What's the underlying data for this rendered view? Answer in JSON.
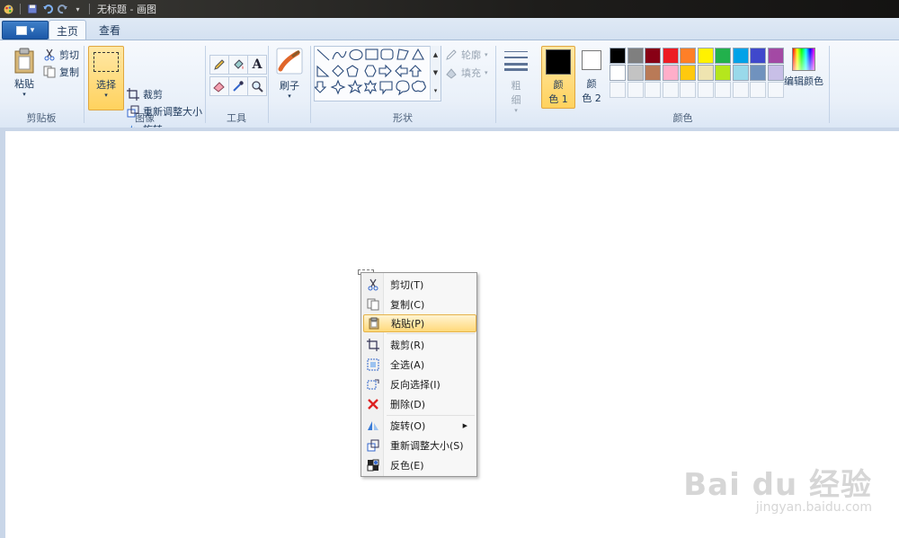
{
  "titlebar": {
    "title": "无标题 - 画图"
  },
  "tabs": [
    {
      "label": "主页",
      "active": true
    },
    {
      "label": "查看",
      "active": false
    }
  ],
  "ribbon": {
    "clipboard": {
      "paste_label": "粘贴",
      "cut_label": "剪切",
      "copy_label": "复制",
      "group_label": "剪贴板"
    },
    "image": {
      "select_label": "选择",
      "crop_label": "裁剪",
      "resize_label": "重新调整大小",
      "rotate_label": "旋转",
      "group_label": "图像"
    },
    "tools": {
      "group_label": "工具",
      "icons": [
        "pencil-icon",
        "fill-icon",
        "text-icon",
        "eraser-icon",
        "color-picker-icon",
        "magnifier-icon"
      ]
    },
    "brushes": {
      "label": "刷子"
    },
    "shapes": {
      "outline_label": "轮廓",
      "fill_label": "填充",
      "group_label": "形状"
    },
    "size": {
      "label_top": "粗",
      "label_bottom": "细"
    },
    "colors": {
      "color1_top": "颜",
      "color1_bottom": "色 1",
      "color2_top": "颜",
      "color2_bottom": "色 2",
      "edit_label": "编辑颜色",
      "group_label": "颜色",
      "color1_value": "#000000",
      "color2_value": "#ffffff",
      "palette_row1": [
        "#000000",
        "#7f7f7f",
        "#880015",
        "#ed1c24",
        "#ff7f27",
        "#fff200",
        "#22b14c",
        "#00a2e8",
        "#3f48cc",
        "#a349a4"
      ],
      "palette_row2": [
        "#ffffff",
        "#c3c3c3",
        "#b97a57",
        "#ffaec9",
        "#ffc90e",
        "#efe4b0",
        "#b5e61d",
        "#99d9ea",
        "#7092be",
        "#c8bfe7"
      ]
    }
  },
  "context_menu": {
    "items": [
      {
        "label": "剪切(T)",
        "icon": "scissors-icon"
      },
      {
        "label": "复制(C)",
        "icon": "copy-icon"
      },
      {
        "label": "粘贴(P)",
        "icon": "paste-icon",
        "highlighted": true
      },
      {
        "label": "裁剪(R)",
        "icon": "crop-icon"
      },
      {
        "label": "全选(A)",
        "icon": "select-all-icon"
      },
      {
        "label": "反向选择(I)",
        "icon": "invert-selection-icon"
      },
      {
        "label": "删除(D)",
        "icon": "delete-icon"
      },
      {
        "label": "旋转(O)",
        "icon": "rotate-icon",
        "submenu": true
      },
      {
        "label": "重新调整大小(S)",
        "icon": "resize-icon"
      },
      {
        "label": "反色(E)",
        "icon": "invert-color-icon"
      }
    ]
  },
  "watermark": {
    "main": "Bai du 经验",
    "sub": "jingyan.baidu.com"
  }
}
